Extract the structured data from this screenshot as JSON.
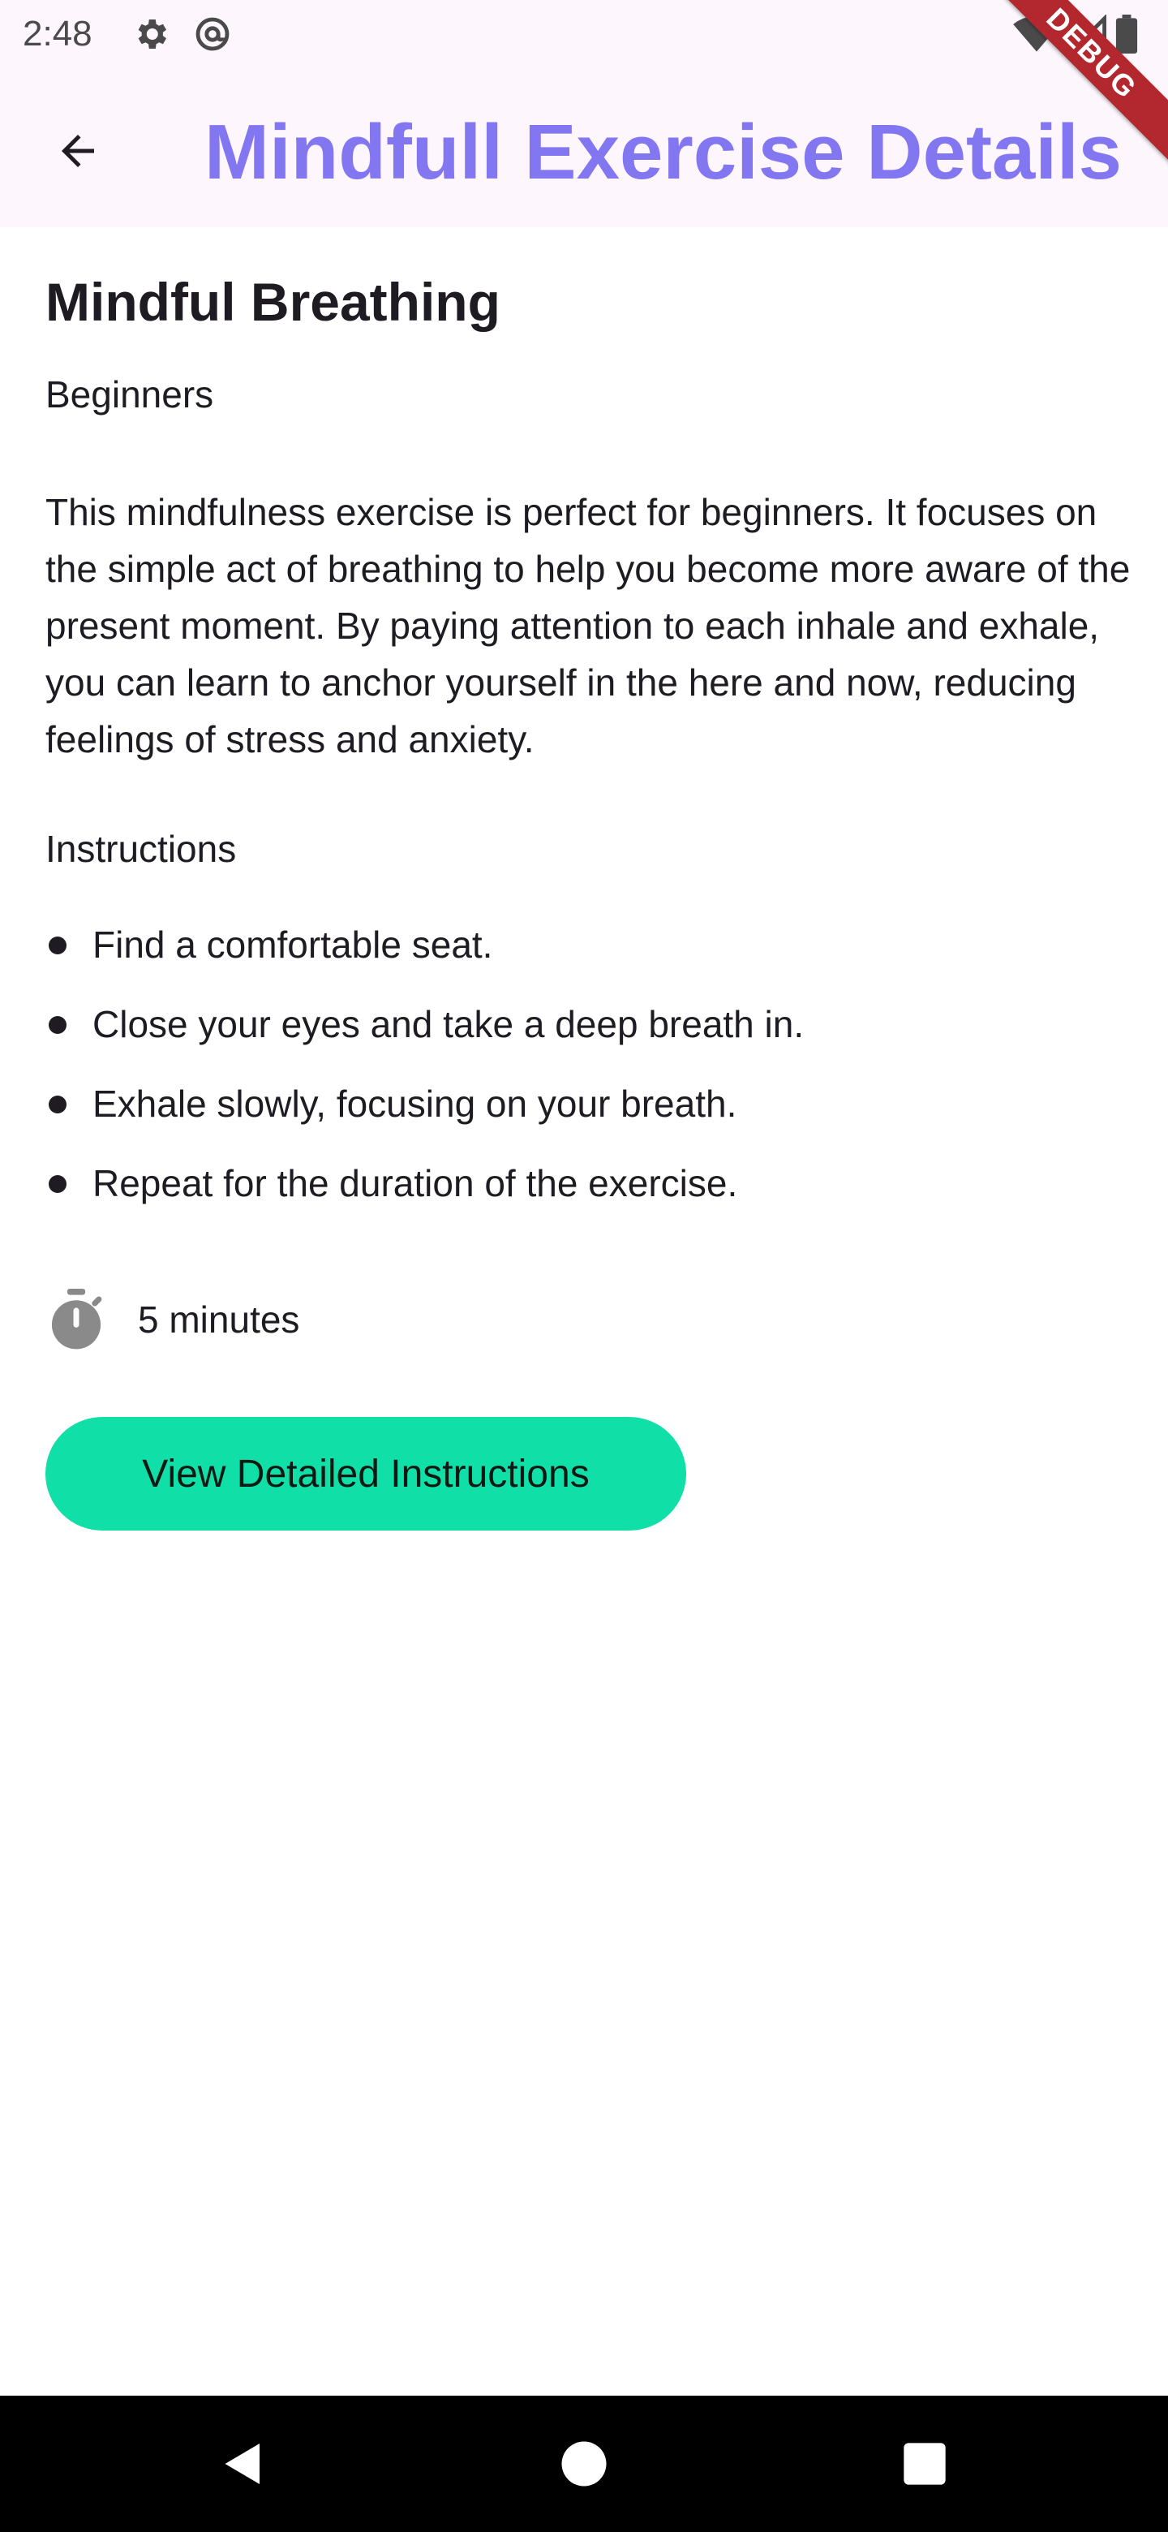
{
  "status_bar": {
    "time": "2:48",
    "icons": [
      "settings-icon",
      "at-sign-icon",
      "wifi-icon",
      "signal-icon",
      "battery-icon"
    ]
  },
  "debug_banner": "DEBUG",
  "app_bar": {
    "title": "Mindfull Exercise Details",
    "title_color": "#8377f1",
    "back_icon": "arrow-back-icon"
  },
  "exercise": {
    "title": "Mindful Breathing",
    "level": "Beginners",
    "description": "This mindfulness exercise is perfect for beginners. It focuses on the simple act of breathing to help you become more aware of the present moment. By paying attention to each inhale and exhale, you can learn to anchor yourself in the here and now, reducing feelings of stress and anxiety.",
    "instructions_heading": "Instructions",
    "steps": [
      "Find a comfortable seat.",
      "Close your eyes and take a deep breath in.",
      "Exhale slowly, focusing on your breath.",
      "Repeat for the duration of the exercise."
    ],
    "duration": "5 minutes",
    "duration_icon": "timer-icon"
  },
  "actions": {
    "view_instructions_label": "View Detailed Instructions",
    "button_color": "#10e0a7"
  },
  "nav_bar": {
    "buttons": [
      "back-triangle-icon",
      "home-circle-icon",
      "recents-square-icon"
    ]
  }
}
